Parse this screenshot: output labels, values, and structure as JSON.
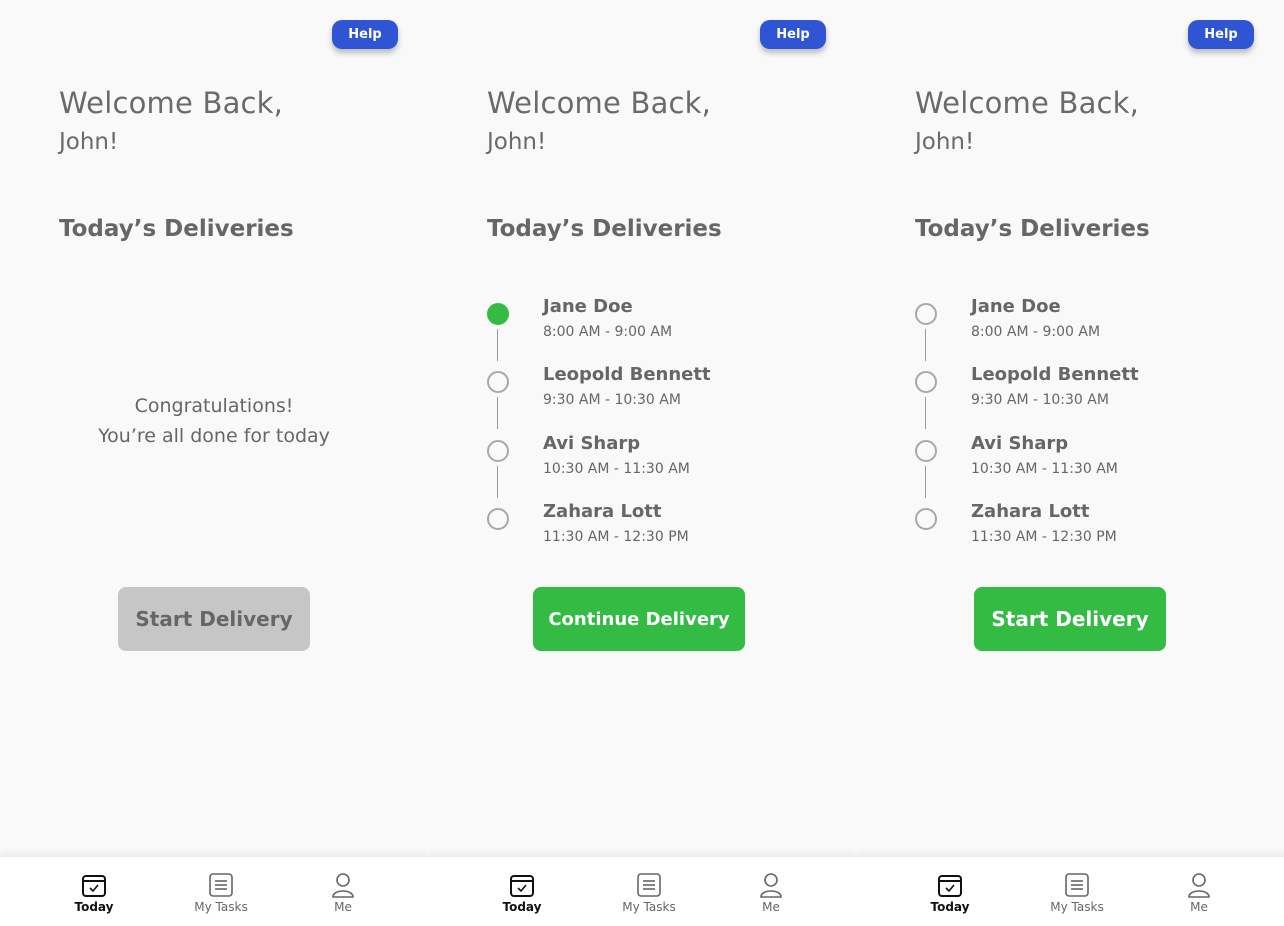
{
  "help_label": "Help",
  "greeting": {
    "line1": "Welcome Back,",
    "line2": "John!"
  },
  "section_title": "Today’s Deliveries",
  "empty_state": {
    "line1": "Congratulations!",
    "line2": "You’re all done for today"
  },
  "deliveries": [
    {
      "name": "Jane Doe",
      "time": "8:00 AM - 9:00 AM"
    },
    {
      "name": "Leopold Bennett",
      "time": "9:30 AM - 10:30 AM"
    },
    {
      "name": "Avi Sharp",
      "time": "10:30 AM - 11:30 AM"
    },
    {
      "name": "Zahara Lott",
      "time": "11:30 AM - 12:30 PM"
    }
  ],
  "buttons": {
    "start_delivery": "Start Delivery",
    "continue_delivery": "Continue  Delivery"
  },
  "tabs": [
    {
      "label": "Today",
      "icon": "calendar-check-icon",
      "active": true
    },
    {
      "label": "My Tasks",
      "icon": "list-icon",
      "active": false
    },
    {
      "label": "Me",
      "icon": "user-icon",
      "active": false
    }
  ],
  "colors": {
    "help_button": "#2f55d4",
    "primary_button": "#33bb44",
    "disabled_button": "#c6c6c6",
    "completed_stop": "#33bb44",
    "text": "#666666"
  },
  "screens": [
    {
      "state": "empty",
      "completed_stops": 0
    },
    {
      "state": "in-progress",
      "completed_stops": 1
    },
    {
      "state": "not-started",
      "completed_stops": 0
    }
  ]
}
